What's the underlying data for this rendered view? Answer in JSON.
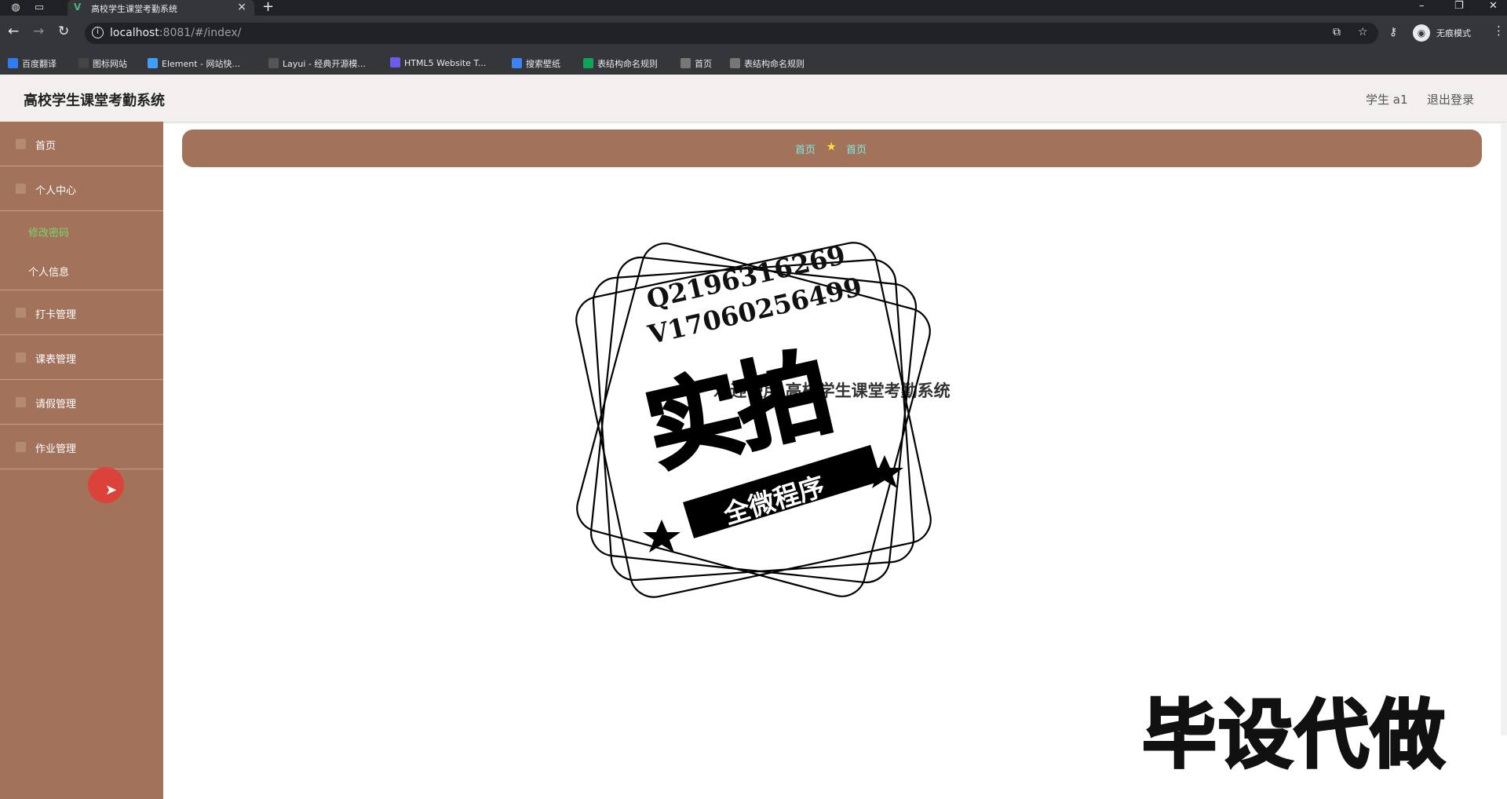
{
  "browser": {
    "tab_title": "高校学生课堂考勤系统",
    "url_host": "localhost",
    "url_rest": ":8081/#/index/",
    "incognito_label": "无痕模式",
    "bookmarks": [
      {
        "label": "百度翻译",
        "icon": "translate-icon",
        "color": "#2f7cf6"
      },
      {
        "label": "图标网站",
        "icon": "flag-icon",
        "color": "#444444"
      },
      {
        "label": "Element - 网站快...",
        "icon": "element-icon",
        "color": "#409eff"
      },
      {
        "label": "Layui - 经典开源模...",
        "icon": "layui-icon",
        "color": "#555555"
      },
      {
        "label": "HTML5 Website T...",
        "icon": "html5-icon",
        "color": "#6c5ce7"
      },
      {
        "label": "搜索壁纸",
        "icon": "wallpaper-icon",
        "color": "#3e82f7"
      },
      {
        "label": "表结构命名规则",
        "icon": "sheet-icon",
        "color": "#12a35b"
      },
      {
        "label": "首页",
        "icon": "globe-icon",
        "color": "#777777"
      },
      {
        "label": "表结构命名规则",
        "icon": "globe-icon",
        "color": "#777777"
      }
    ]
  },
  "app": {
    "title": "高校学生课堂考勤系统",
    "user": "学生 a1",
    "logout": "退出登录",
    "menu": {
      "home": "首页",
      "personal_center": "个人中心",
      "change_password": "修改密码",
      "personal_info": "个人信息",
      "checkin": "打卡管理",
      "schedule": "课表管理",
      "leave": "请假管理",
      "homework": "作业管理"
    },
    "breadcrumb": {
      "first": "首页",
      "second": "首页"
    },
    "welcome": "欢迎使用 高校学生课堂考勤系统"
  },
  "watermark": {
    "qq": "Q2196316269",
    "wechat": "V17060256499",
    "big": "实拍",
    "banner": "全微程序",
    "corner": "毕设代做"
  },
  "colors": {
    "sidebar": "#a2725a",
    "active_submenu": "#7bd66b",
    "breadcrumb_text": "#7fe9e4",
    "star": "#ffd54a"
  }
}
